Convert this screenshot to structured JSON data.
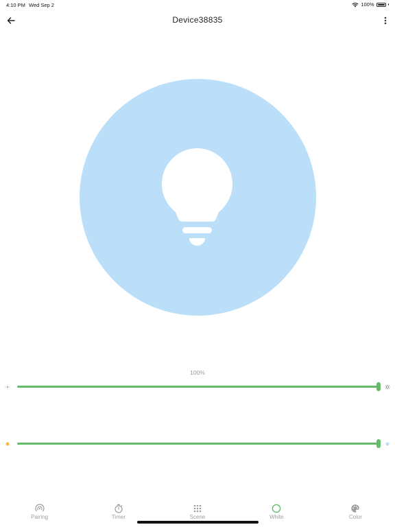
{
  "status": {
    "time": "4:10 PM",
    "date": "Wed Sep 2",
    "battery": "100%",
    "battery_level": 1.0
  },
  "header": {
    "title": "Device38835"
  },
  "bulb": {
    "color": "#bbdff9"
  },
  "brightness": {
    "label": "100%",
    "value": 1.0,
    "left_icon": "brightness-low-icon",
    "right_icon": "brightness-high-icon"
  },
  "temperature": {
    "value": 1.0,
    "left_color": "#f5b942",
    "right_color": "#bbdff9"
  },
  "accent_color": "#66bb6a",
  "tabs": [
    {
      "label": "Pairing",
      "icon": "pairing-icon"
    },
    {
      "label": "Timer",
      "icon": "timer-icon"
    },
    {
      "label": "Scene",
      "icon": "scene-grid-icon"
    },
    {
      "label": "White",
      "icon": "white-circle-icon",
      "active": true
    },
    {
      "label": "Color",
      "icon": "palette-icon"
    }
  ]
}
